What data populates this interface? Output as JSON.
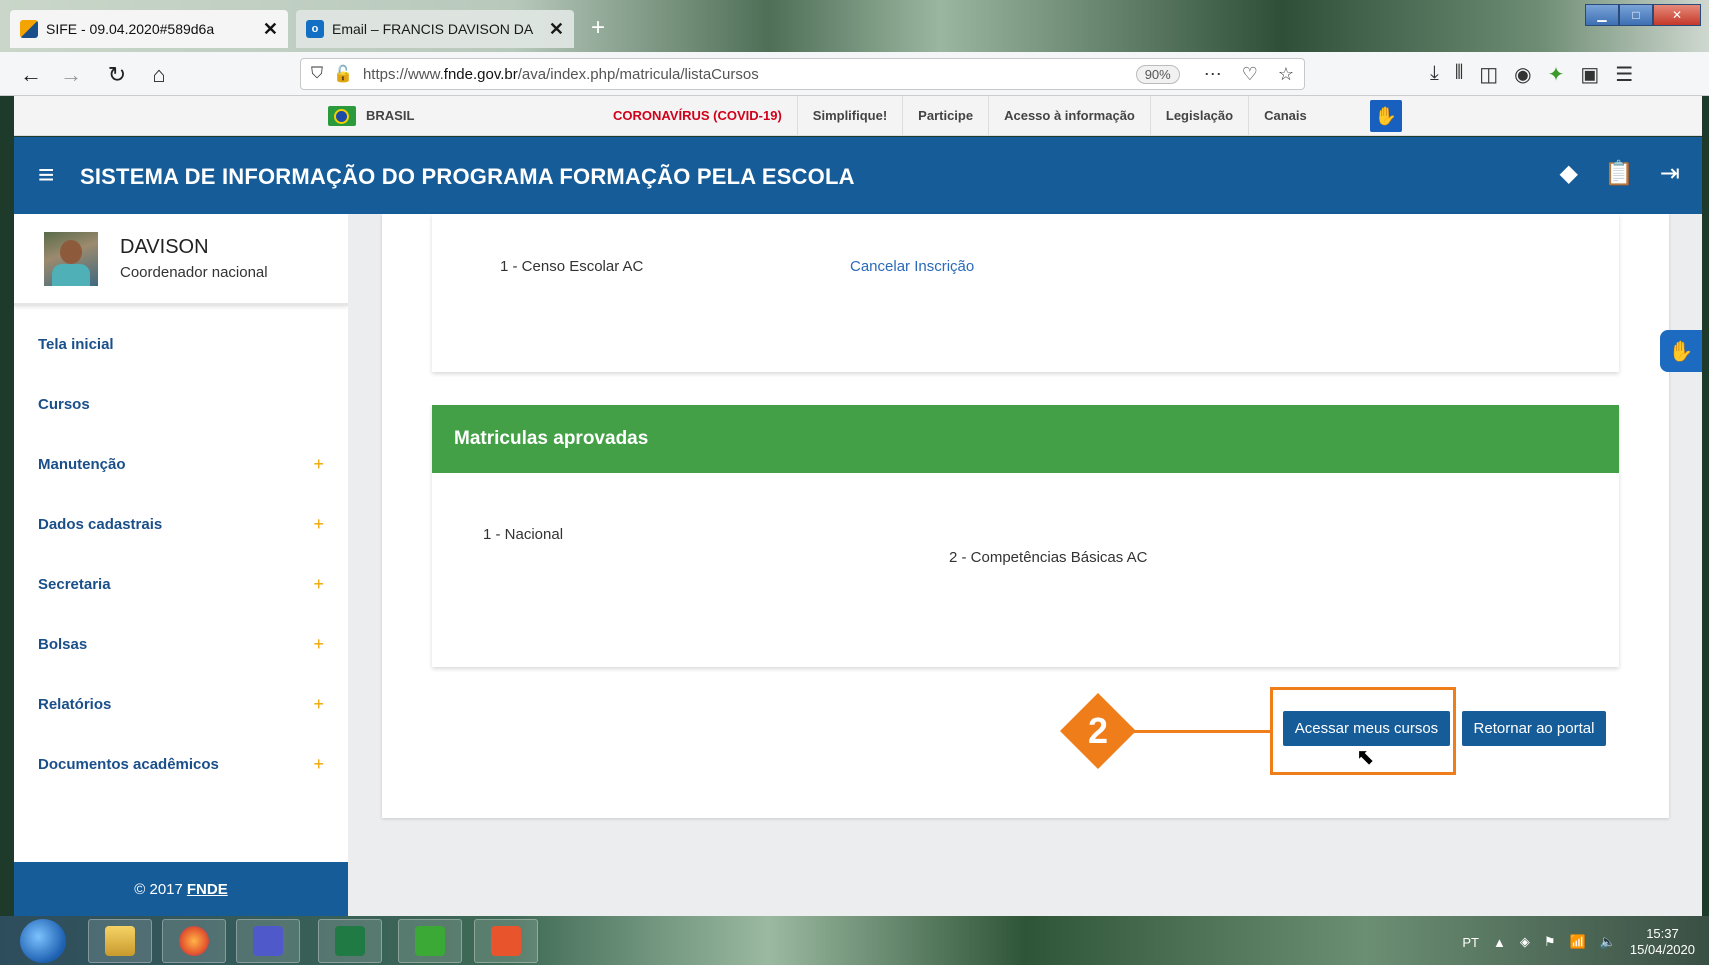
{
  "browser": {
    "tabs": [
      {
        "label": "SIFE - 09.04.2020#589d6a",
        "active": true
      },
      {
        "label": "Email – FRANCIS DAVISON DA",
        "active": false
      }
    ],
    "url_prefix": "https://www.",
    "url_domain": "fnde.gov.br",
    "url_path": "/ava/index.php/matricula/listaCursos",
    "zoom": "90%",
    "new_tab": "+"
  },
  "govbar": {
    "brasil": "BRASIL",
    "links": [
      "CORONAVÍRUS (COVID-19)",
      "Simplifique!",
      "Participe",
      "Acesso à informação",
      "Legislação",
      "Canais"
    ]
  },
  "header": {
    "title": "SISTEMA DE INFORMAÇÃO DO PROGRAMA FORMAÇÃO PELA ESCOLA"
  },
  "user": {
    "name": "DAVISON",
    "role": "Coordenador nacional"
  },
  "sidebar": {
    "items": [
      {
        "label": "Tela inicial",
        "expandable": false
      },
      {
        "label": "Cursos",
        "expandable": false
      },
      {
        "label": "Manutenção",
        "expandable": true
      },
      {
        "label": "Dados cadastrais",
        "expandable": true
      },
      {
        "label": "Secretaria",
        "expandable": true
      },
      {
        "label": "Bolsas",
        "expandable": true
      },
      {
        "label": "Relatórios",
        "expandable": true
      },
      {
        "label": "Documentos acadêmicos",
        "expandable": true
      }
    ],
    "expand_symbol": "+",
    "footer_copyright": "© 2017",
    "footer_org": "FNDE"
  },
  "pending": {
    "course": "1 - Censo Escolar AC",
    "cancel_link": "Cancelar Inscrição"
  },
  "approved": {
    "title": "Matriculas aprovadas",
    "courses": [
      "1 - Nacional",
      "2 - Competências Básicas AC"
    ]
  },
  "actions": {
    "access": "Acessar meus cursos",
    "back": "Retornar ao portal"
  },
  "annotation": {
    "step": "2",
    "color": "#ef7d1a"
  },
  "taskbar": {
    "lang": "PT",
    "time": "15:37",
    "date": "15/04/2020"
  }
}
